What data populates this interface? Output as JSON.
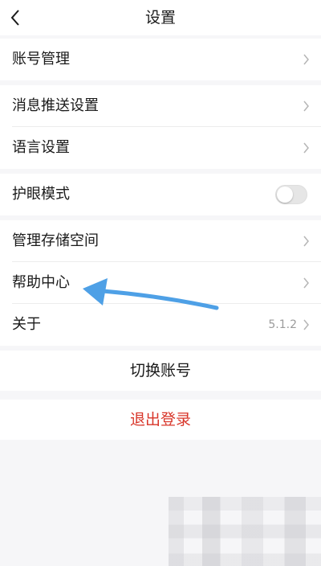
{
  "header": {
    "title": "设置",
    "back_icon": "chevron-left-icon"
  },
  "account": {
    "label": "账号管理"
  },
  "notifications": {
    "push_label": "消息推送设置",
    "language_label": "语言设置"
  },
  "eye_care": {
    "label": "护眼模式",
    "enabled": false
  },
  "misc": {
    "storage_label": "管理存储空间",
    "help_label": "帮助中心",
    "about_label": "关于",
    "version": "5.1.2"
  },
  "actions": {
    "switch_account": "切换账号",
    "logout": "退出登录"
  },
  "colors": {
    "logout": "#d8362a",
    "arrow": "#4ea0e6",
    "background": "#f6f6f8"
  }
}
